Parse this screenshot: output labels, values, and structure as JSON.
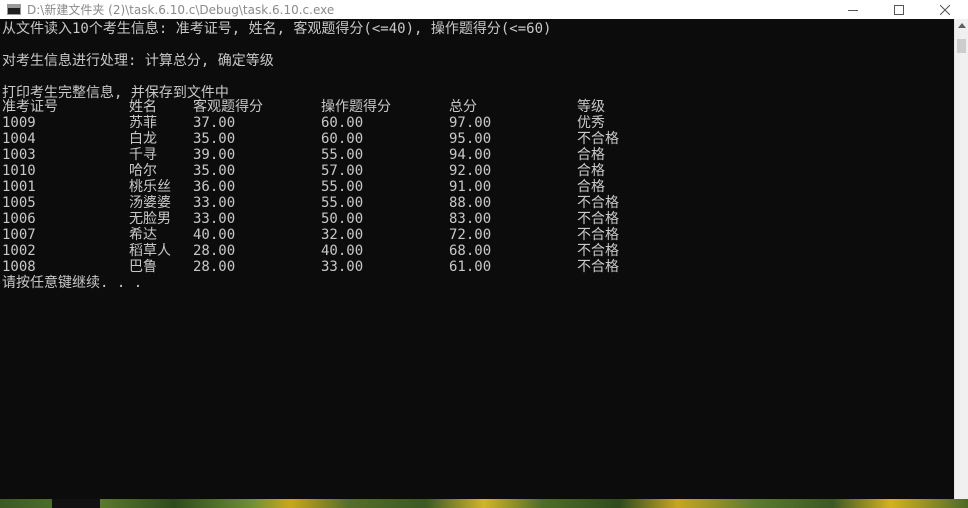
{
  "window": {
    "title": "D:\\新建文件夹 (2)\\task.6.10.c\\Debug\\task.6.10.c.exe"
  },
  "console": {
    "line1": "从文件读入10个考生信息: 准考证号, 姓名, 客观题得分(<=40), 操作题得分(<=60)",
    "line2": "对考生信息进行处理: 计算总分, 确定等级",
    "line3": "打印考生完整信息, 并保存到文件中",
    "headers": [
      "准考证号",
      "姓名",
      "客观题得分",
      "操作题得分",
      "总分",
      "等级"
    ],
    "rows": [
      [
        "1009",
        "苏菲",
        "37.00",
        "60.00",
        "97.00",
        "优秀"
      ],
      [
        "1004",
        "白龙",
        "35.00",
        "60.00",
        "95.00",
        "不合格"
      ],
      [
        "1003",
        "千寻",
        "39.00",
        "55.00",
        "94.00",
        "合格"
      ],
      [
        "1010",
        "哈尔",
        "35.00",
        "57.00",
        "92.00",
        "合格"
      ],
      [
        "1001",
        "桃乐丝",
        "36.00",
        "55.00",
        "91.00",
        "合格"
      ],
      [
        "1005",
        "汤婆婆",
        "33.00",
        "55.00",
        "88.00",
        "不合格"
      ],
      [
        "1006",
        "无脸男",
        "33.00",
        "50.00",
        "83.00",
        "不合格"
      ],
      [
        "1007",
        "希达",
        "40.00",
        "32.00",
        "72.00",
        "不合格"
      ],
      [
        "1002",
        "稻草人",
        "28.00",
        "40.00",
        "68.00",
        "不合格"
      ],
      [
        "1008",
        "巴鲁",
        "28.00",
        "33.00",
        "61.00",
        "不合格"
      ]
    ],
    "prompt": "请按任意键继续. . ."
  },
  "icons": {
    "app": "console-app-icon",
    "minimize": "minimize-icon",
    "maximize": "maximize-icon",
    "close": "close-icon",
    "scroll_up": "scroll-up-arrow-icon"
  },
  "colors": {
    "console_bg": "#0c0c0c",
    "console_text": "#c8c8c8",
    "titlebar_bg": "#ffffff"
  }
}
